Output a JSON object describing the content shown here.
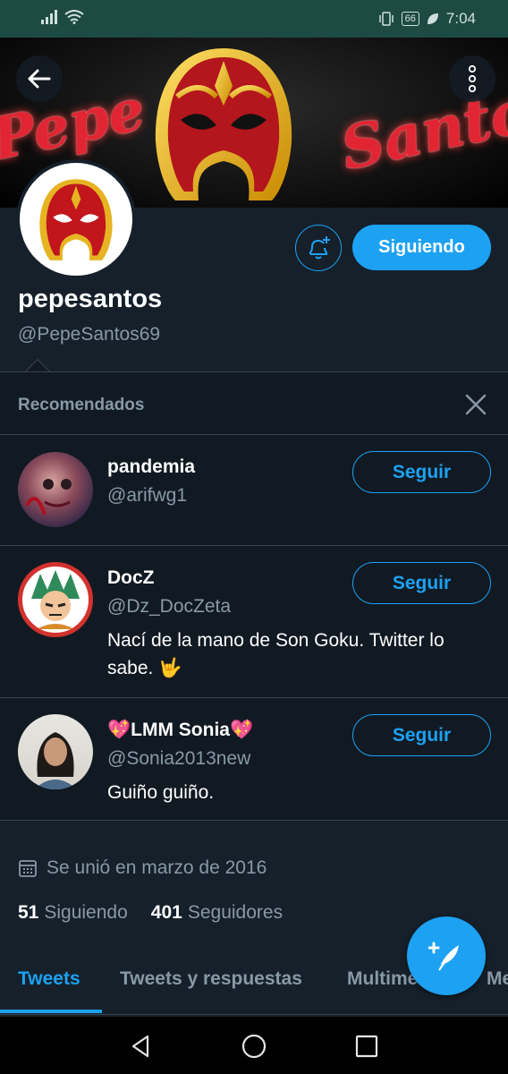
{
  "status_bar": {
    "battery": "66",
    "time": "7:04"
  },
  "banner": {
    "word_left": "Pepe",
    "word_right": "Santos"
  },
  "profile": {
    "name": "pepesantos",
    "handle": "@PepeSantos69",
    "following_button": "Siguiendo",
    "joined": "Se unió en marzo de 2016",
    "following_count": "51",
    "following_label": "Siguiendo",
    "followers_count": "401",
    "followers_label": "Seguidores"
  },
  "recommended": {
    "title": "Recomendados",
    "items": [
      {
        "name": "pandemia",
        "handle": "@arifwg1",
        "bio": "",
        "button": "Seguir"
      },
      {
        "name": "DocZ",
        "handle": "@Dz_DocZeta",
        "bio": "Nací de la mano de Son Goku. Twitter lo sabe. 🤟",
        "button": "Seguir"
      },
      {
        "name": "💖LMM Sonia💖",
        "handle": "@Sonia2013new",
        "bio": "Guiño guiño.",
        "button": "Seguir"
      }
    ]
  },
  "tabs": [
    "Tweets",
    "Tweets y respuestas",
    "Multimedia",
    "Me gusta"
  ],
  "colors": {
    "accent": "#1da1f2",
    "background": "#15202b",
    "panel": "#111a23",
    "muted": "#8899a6"
  }
}
